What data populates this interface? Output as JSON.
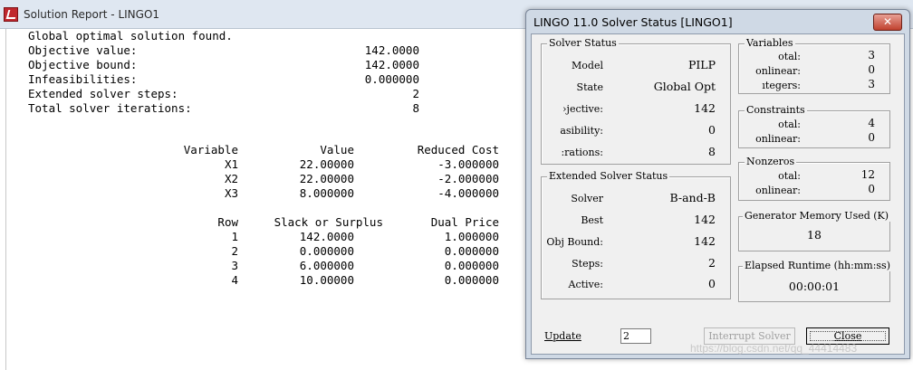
{
  "report": {
    "title": "Solution Report - LINGO1",
    "summary_lines": [
      {
        "label": "Global optimal solution found.",
        "value": ""
      },
      {
        "label": "Objective value:",
        "value": "142.0000"
      },
      {
        "label": "Objective bound:",
        "value": "142.0000"
      },
      {
        "label": "Infeasibilities:",
        "value": "0.000000"
      },
      {
        "label": "Extended solver steps:",
        "value": "2"
      },
      {
        "label": "Total solver iterations:",
        "value": "8"
      }
    ],
    "variable_table": {
      "headers": [
        "Variable",
        "Value",
        "Reduced Cost"
      ],
      "rows": [
        [
          "X1",
          "22.00000",
          "-3.000000"
        ],
        [
          "X2",
          "22.00000",
          "-2.000000"
        ],
        [
          "X3",
          "8.000000",
          "-4.000000"
        ]
      ]
    },
    "row_table": {
      "headers": [
        "Row",
        "Slack or Surplus",
        "Dual Price"
      ],
      "rows": [
        [
          "1",
          "142.0000",
          "1.000000"
        ],
        [
          "2",
          "0.000000",
          "0.000000"
        ],
        [
          "3",
          "6.000000",
          "0.000000"
        ],
        [
          "4",
          "10.00000",
          "0.000000"
        ]
      ]
    }
  },
  "dialog": {
    "title": "LINGO 11.0 Solver Status [LINGO1]",
    "close_glyph": "✕",
    "solver_status": {
      "label": "Solver Status",
      "items": [
        {
          "label": "Model",
          "value": "PILP"
        },
        {
          "label": "State",
          "value": "Global Opt"
        },
        {
          "label": "›jective:",
          "value": "142"
        },
        {
          "label": "asibility:",
          "value": "0"
        },
        {
          "label": ":rations:",
          "value": "8"
        }
      ]
    },
    "extended_status": {
      "label": "Extended Solver Status",
      "items": [
        {
          "label": "Solver",
          "value": "B-and-B"
        },
        {
          "label": "Best",
          "value": "142"
        },
        {
          "label": "Obj Bound:",
          "value": "142"
        },
        {
          "label": "Steps:",
          "value": "2"
        },
        {
          "label": "Active:",
          "value": "0"
        }
      ]
    },
    "variables": {
      "label": "Variables",
      "items": [
        {
          "label": "otal:",
          "value": "3"
        },
        {
          "label": "onlinear:",
          "value": "0"
        },
        {
          "label": "ıtegers:",
          "value": "3"
        }
      ]
    },
    "constraints": {
      "label": "Constraints",
      "items": [
        {
          "label": "otal:",
          "value": "4"
        },
        {
          "label": "onlinear:",
          "value": "0"
        }
      ]
    },
    "nonzeros": {
      "label": "Nonzeros",
      "items": [
        {
          "label": "otal:",
          "value": "12"
        },
        {
          "label": "onlinear:",
          "value": "0"
        }
      ]
    },
    "generator_memory": {
      "label": "Generator Memory Used (K)",
      "value": "18"
    },
    "elapsed_runtime": {
      "label": "Elapsed Runtime (hh:mm:ss)",
      "value": "00:00:01"
    },
    "update": {
      "label": "Update",
      "value": "2"
    },
    "interrupt_label": "Interrupt Solver",
    "close_label": "Close"
  },
  "watermark": "https://blog.csdn.net/qq_44414483"
}
